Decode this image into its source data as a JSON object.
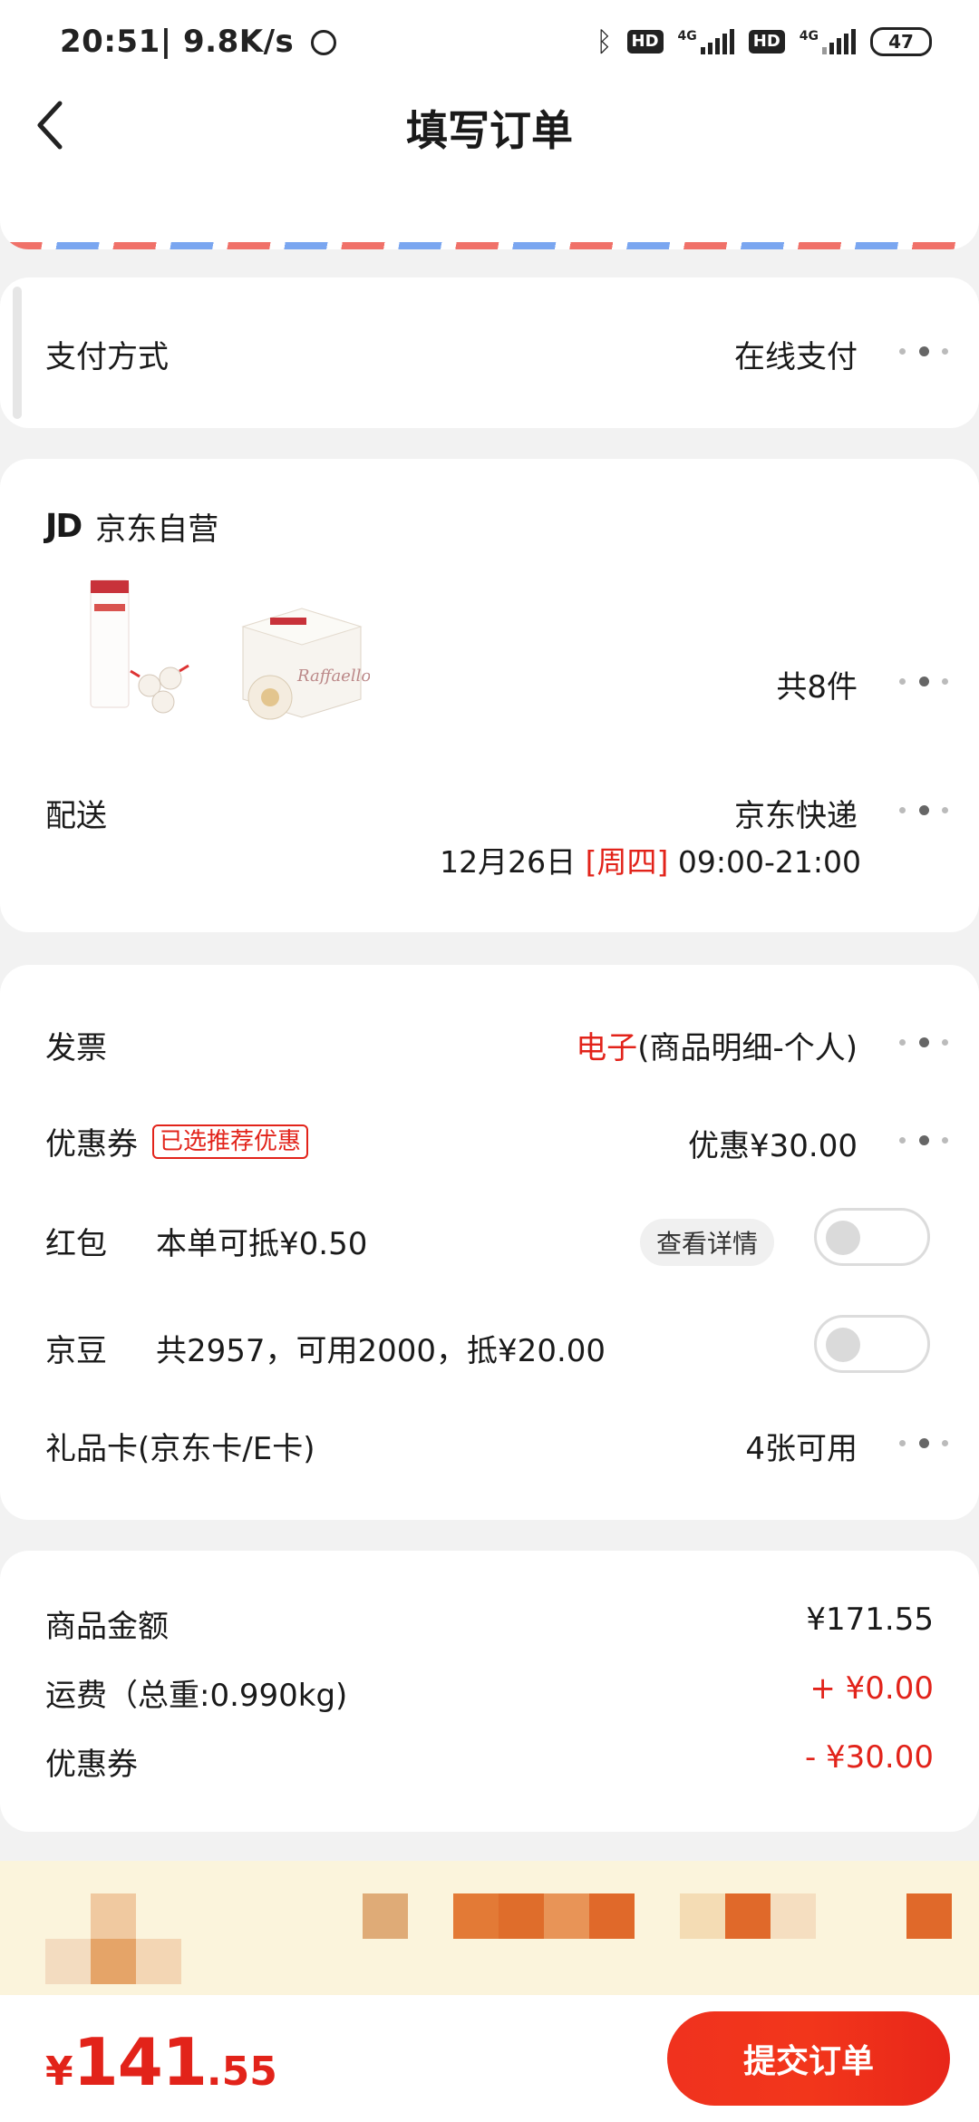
{
  "status_bar": {
    "time": "20:51",
    "speed": "| 9.8K/s",
    "hd_label": "HD",
    "network": "4G",
    "battery": "47"
  },
  "header": {
    "title": "填写订单"
  },
  "payment": {
    "label": "支付方式",
    "value": "在线支付"
  },
  "store": {
    "logo": "JD",
    "name": "京东自营",
    "item_count": "共8件",
    "delivery_label": "配送",
    "delivery_value": "京东快递",
    "delivery_date": "12月26日",
    "delivery_weekday": "[周四]",
    "delivery_time": "09:00-21:00"
  },
  "benefits": {
    "invoice_label": "发票",
    "invoice_type": "电子",
    "invoice_detail": "(商品明细-个人)",
    "coupon_label": "优惠券",
    "coupon_tag": "已选推荐优惠",
    "coupon_value": "优惠¥30.00",
    "redpacket_label": "红包",
    "redpacket_desc": "本单可抵¥0.50",
    "redpacket_detail_btn": "查看详情",
    "beans_label": "京豆",
    "beans_desc": "共2957，可用2000，抵¥20.00",
    "giftcard_label": "礼品卡(京东卡/E卡)",
    "giftcard_value": "4张可用"
  },
  "summary": {
    "goods_label": "商品金额",
    "goods_value": "¥171.55",
    "freight_label": "运费（总重:0.990kg)",
    "freight_value": "+ ¥0.00",
    "coupon_label": "优惠券",
    "coupon_value": "- ¥30.00"
  },
  "bottom": {
    "currency": "¥",
    "total_int": "141",
    "total_dec": ".55",
    "submit_label": "提交订单"
  },
  "colors": {
    "accent": "#e2231a",
    "banner": "#fbf4dc"
  }
}
